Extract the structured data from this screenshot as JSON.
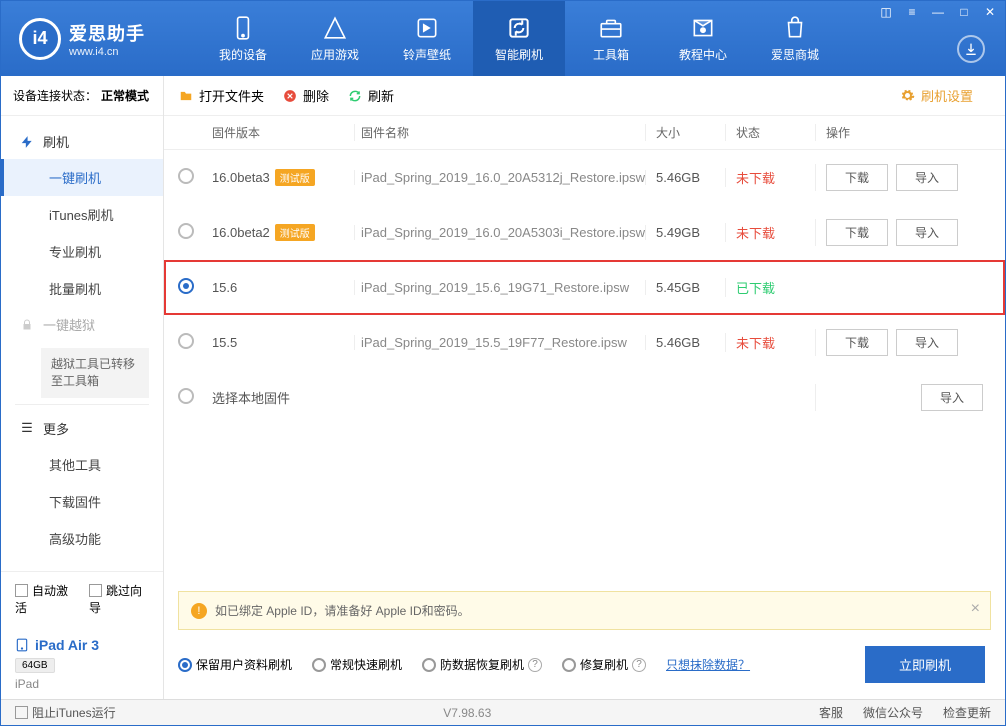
{
  "app": {
    "name": "爱思助手",
    "url": "www.i4.cn"
  },
  "nav": [
    {
      "label": "我的设备"
    },
    {
      "label": "应用游戏"
    },
    {
      "label": "铃声壁纸"
    },
    {
      "label": "智能刷机"
    },
    {
      "label": "工具箱"
    },
    {
      "label": "教程中心"
    },
    {
      "label": "爱思商城"
    }
  ],
  "status": {
    "label": "设备连接状态：",
    "value": "正常模式"
  },
  "sidebar": {
    "flash_group": "刷机",
    "items": [
      "一键刷机",
      "iTunes刷机",
      "专业刷机",
      "批量刷机"
    ],
    "jailbreak_group": "一键越狱",
    "jailbreak_note": "越狱工具已转移至工具箱",
    "more_group": "更多",
    "more_items": [
      "其他工具",
      "下载固件",
      "高级功能"
    ]
  },
  "bottom": {
    "auto_activate": "自动激活",
    "skip_guide": "跳过向导",
    "device_name": "iPad Air 3",
    "capacity": "64GB",
    "device_type": "iPad"
  },
  "toolbar": {
    "open_folder": "打开文件夹",
    "delete": "删除",
    "refresh": "刷新",
    "settings": "刷机设置"
  },
  "columns": {
    "version": "固件版本",
    "name": "固件名称",
    "size": "大小",
    "status": "状态",
    "action": "操作"
  },
  "firmware": [
    {
      "ver": "16.0beta3",
      "beta": "测试版",
      "name": "iPad_Spring_2019_16.0_20A5312j_Restore.ipsw",
      "size": "5.46GB",
      "status": "未下载",
      "status_cls": "status-nd",
      "sel": false,
      "dl": true
    },
    {
      "ver": "16.0beta2",
      "beta": "测试版",
      "name": "iPad_Spring_2019_16.0_20A5303i_Restore.ipsw",
      "size": "5.49GB",
      "status": "未下载",
      "status_cls": "status-nd",
      "sel": false,
      "dl": true
    },
    {
      "ver": "15.6",
      "beta": "",
      "name": "iPad_Spring_2019_15.6_19G71_Restore.ipsw",
      "size": "5.45GB",
      "status": "已下载",
      "status_cls": "status-dl",
      "sel": true,
      "dl": false,
      "highlight": true
    },
    {
      "ver": "15.5",
      "beta": "",
      "name": "iPad_Spring_2019_15.5_19F77_Restore.ipsw",
      "size": "5.46GB",
      "status": "未下载",
      "status_cls": "status-nd",
      "sel": false,
      "dl": true
    }
  ],
  "local_fw": "选择本地固件",
  "buttons": {
    "download": "下载",
    "import": "导入"
  },
  "tip": "如已绑定 Apple ID，请准备好 Apple ID和密码。",
  "flash_opts": {
    "keep_data": "保留用户资料刷机",
    "normal": "常规快速刷机",
    "recovery": "防数据恢复刷机",
    "repair": "修复刷机",
    "erase_link": "只想抹除数据？",
    "flash_now": "立即刷机"
  },
  "footer": {
    "block_itunes": "阻止iTunes运行",
    "version": "V7.98.63",
    "service": "客服",
    "wechat": "微信公众号",
    "update": "检查更新"
  }
}
